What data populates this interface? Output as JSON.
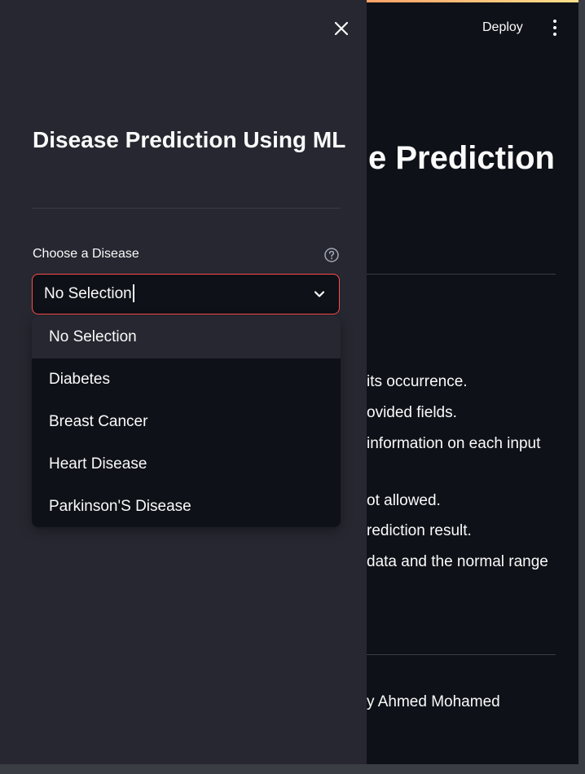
{
  "header": {
    "deploy_label": "Deploy",
    "menu_icon": "kebab-menu-icon"
  },
  "main": {
    "title_partial": "e Prediction",
    "lines": [
      "its occurrence.",
      "ovided fields.",
      "information on each input",
      "ot allowed.",
      "rediction result.",
      "data and the normal range"
    ],
    "footer_partial": "y Ahmed Mohamed"
  },
  "sidebar": {
    "title": "Disease Prediction Using ML",
    "select": {
      "label": "Choose a Disease",
      "value": "No Selection",
      "help_icon": "question-circle-icon",
      "options": [
        "No Selection",
        "Diabetes",
        "Breast Cancer",
        "Heart Disease",
        "Parkinson'S Disease"
      ]
    }
  },
  "colors": {
    "accent": "#ff4b4b",
    "sidebar_bg": "#262730",
    "main_bg": "#0e1117",
    "text": "#fafafa"
  }
}
